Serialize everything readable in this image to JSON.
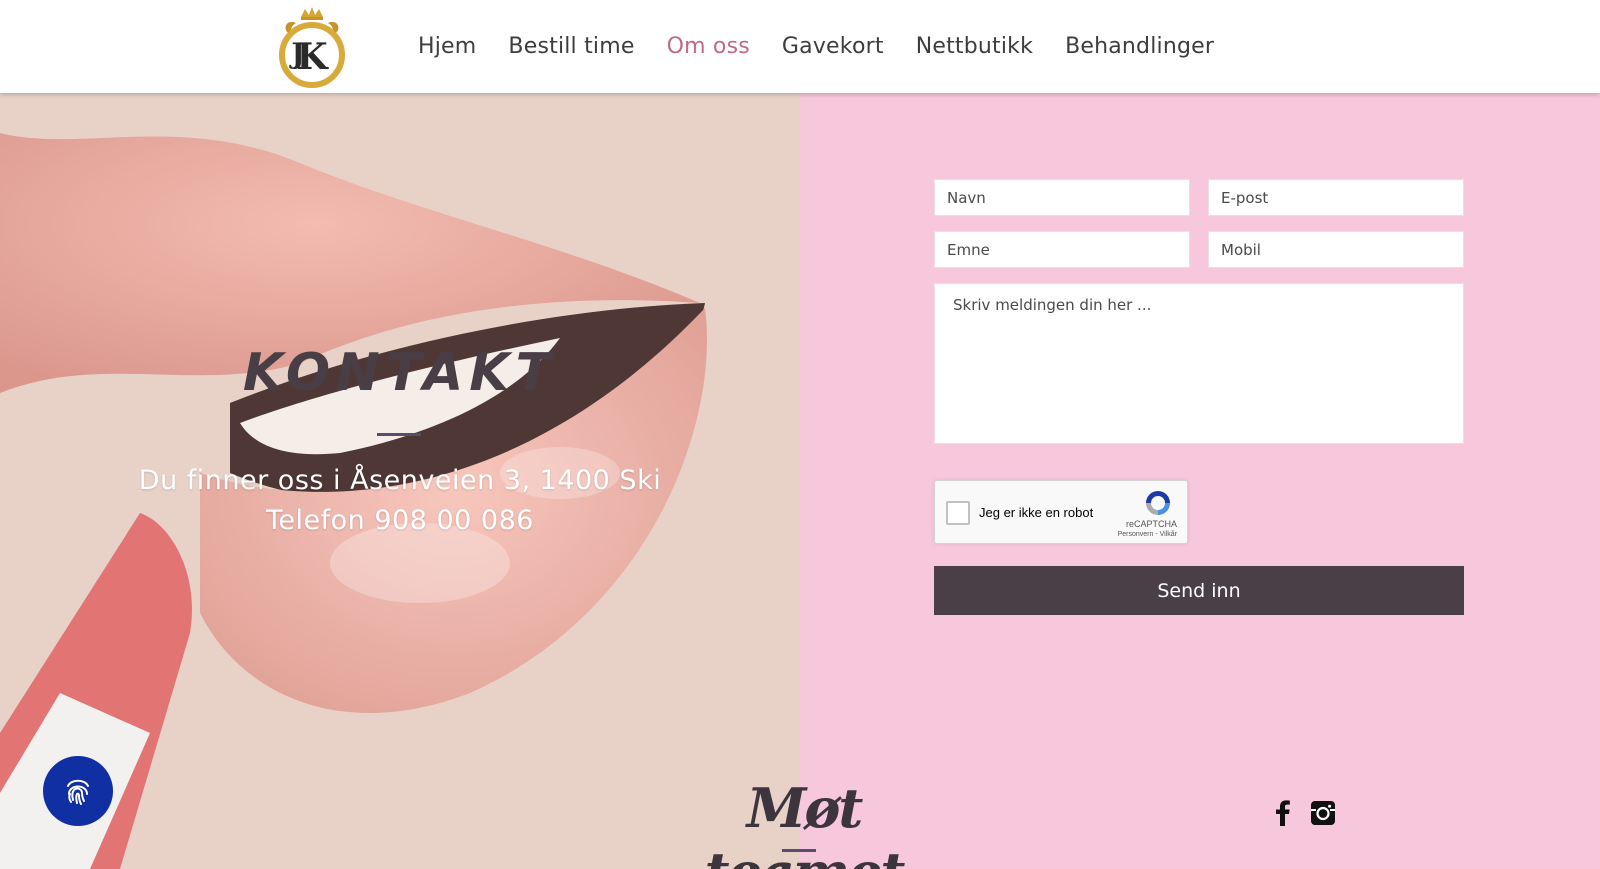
{
  "header": {
    "logo_alt": "JK",
    "nav": [
      {
        "label": "Hjem"
      },
      {
        "label": "Bestill time"
      },
      {
        "label": "Om oss",
        "active": true
      },
      {
        "label": "Gavekort"
      },
      {
        "label": "Nettbutikk"
      },
      {
        "label": "Behandlinger"
      }
    ]
  },
  "hero": {
    "title": "KONTAKT",
    "address": "Du finner oss i Åsenveien 3, 1400 Ski",
    "phone": "Telefon 908 00 086"
  },
  "form": {
    "name_placeholder": "Navn",
    "email_placeholder": "E-post",
    "subject_placeholder": "Emne",
    "mobile_placeholder": "Mobil",
    "message_placeholder": "Skriv meldingen din her ...",
    "captcha_label": "Jeg er ikke en robot",
    "captcha_brand": "reCAPTCHA",
    "captcha_terms": "Personvern - Vilkår",
    "submit_label": "Send inn"
  },
  "team": {
    "title": "Møt teamet"
  },
  "social": {
    "facebook_icon": "facebook-icon",
    "instagram_icon": "instagram-icon"
  },
  "accessibility": {
    "icon": "fingerprint-icon"
  },
  "colors": {
    "active_nav": "#c06a86",
    "panel_bg": "#f7c7dc",
    "submit_bg": "#4a3f47",
    "fab_bg": "#0f2fa3"
  }
}
